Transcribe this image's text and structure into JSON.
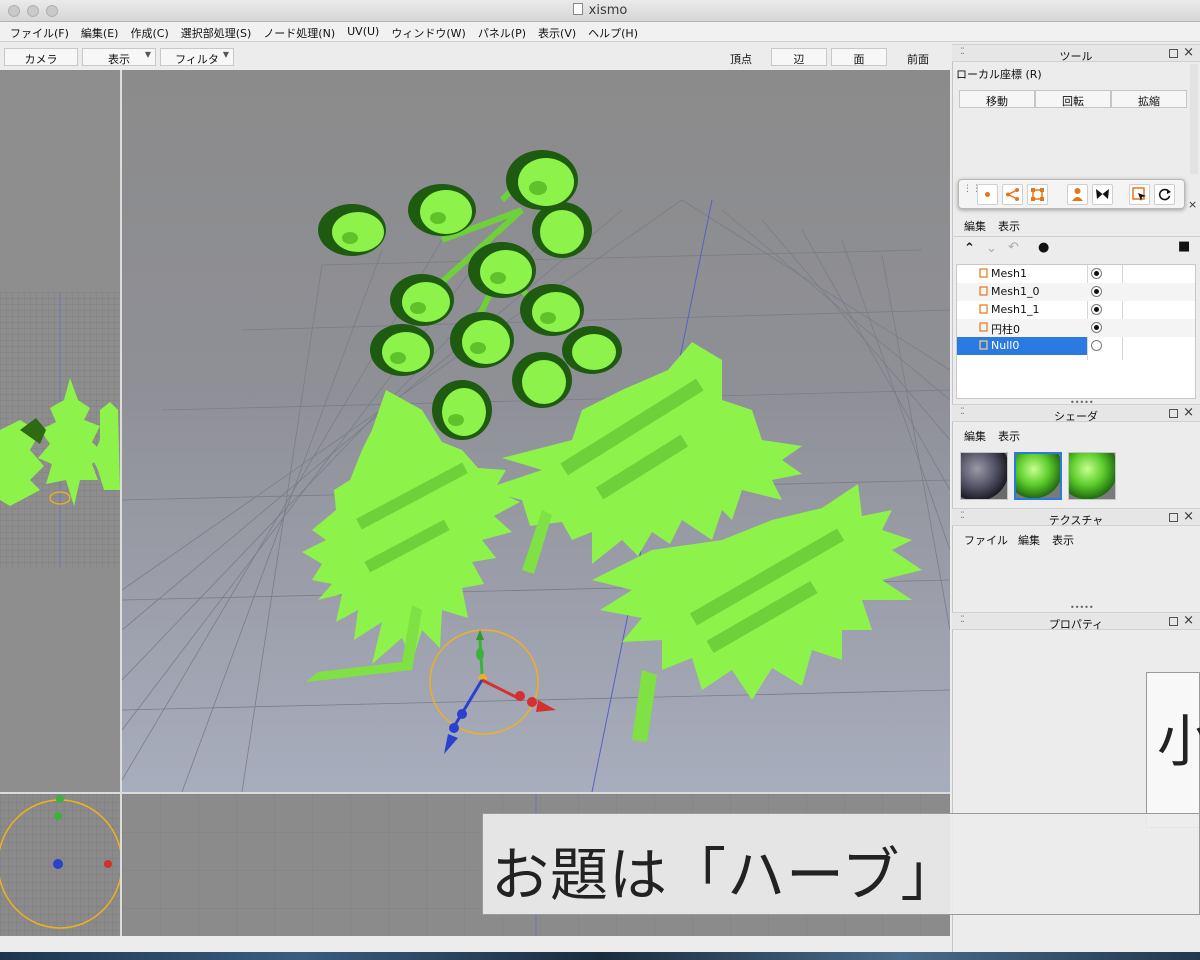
{
  "window": {
    "title": "xismo"
  },
  "menu": [
    "ファイル(F)",
    "編集(E)",
    "作成(C)",
    "選択部処理(S)",
    "ノード処理(N)",
    "UV(U)",
    "ウィンドウ(W)",
    "パネル(P)",
    "表示(V)",
    "ヘルプ(H)"
  ],
  "viewport_toolbar": {
    "camera": "カメラ",
    "display": "表示",
    "filter": "フィルタ",
    "vertex": "頂点",
    "edge": "辺",
    "face": "面",
    "view_name": "前面"
  },
  "tool_panel": {
    "title": "ツール",
    "coord": "ローカル座標 (R)",
    "move": "移動",
    "rotate": "回転",
    "scale": "拡縮"
  },
  "icon_toolbar": {
    "icons": [
      "vertex-dot-icon",
      "share-nodes-icon",
      "mesh-bounds-icon",
      "person-icon",
      "butterfly-icon",
      "select-arrow-icon",
      "rotate-icon"
    ],
    "accent": "#e8741c"
  },
  "scene_panel": {
    "menu_edit": "編集",
    "menu_view": "表示",
    "items": [
      {
        "name": "Mesh1",
        "visible": true,
        "selected": false
      },
      {
        "name": "Mesh1_0",
        "visible": true,
        "selected": false
      },
      {
        "name": "Mesh1_1",
        "visible": true,
        "selected": false
      },
      {
        "name": "円柱0",
        "visible": true,
        "selected": false
      },
      {
        "name": "Null0",
        "visible": false,
        "selected": true
      }
    ]
  },
  "shader_panel": {
    "title": "シェーダ",
    "menu_edit": "編集",
    "menu_view": "表示"
  },
  "texture_panel": {
    "title": "テクスチャ",
    "menu_file": "ファイル",
    "menu_edit": "編集",
    "menu_view": "表示"
  },
  "property_panel": {
    "title": "プロパティ"
  },
  "captions": {
    "main": "お題は「ハーブ」",
    "side": "小"
  },
  "colors": {
    "leaf": "#8df24a",
    "leaf_dark": "#5fc22a",
    "selection": "#2a7ae2",
    "gizmo_ring": "#f0b020"
  }
}
